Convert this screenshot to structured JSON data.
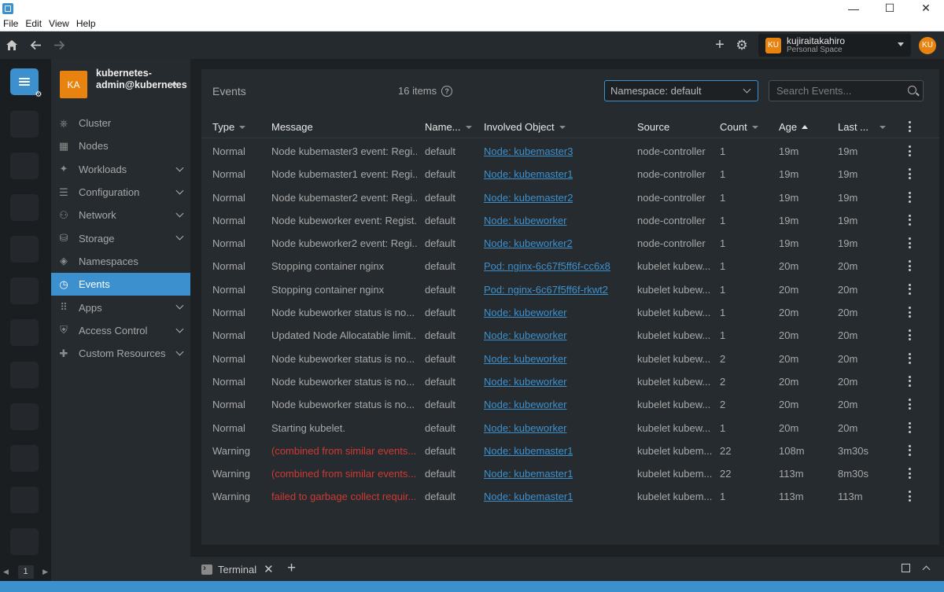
{
  "menu": [
    "File",
    "Edit",
    "View",
    "Help"
  ],
  "window_controls": {
    "minimize": "—",
    "maximize": "☐",
    "close": "✕"
  },
  "space": {
    "initials": "KU",
    "user": "kujiraitakahiro",
    "subtitle": "Personal Space"
  },
  "user_avatar": "KU",
  "cluster": {
    "initials": "KA",
    "name": "kubernetes-admin@kubernetes"
  },
  "nav": [
    {
      "label": "Cluster",
      "icon": "cluster-icon",
      "expandable": false
    },
    {
      "label": "Nodes",
      "icon": "nodes-icon",
      "expandable": false
    },
    {
      "label": "Workloads",
      "icon": "workloads-icon",
      "expandable": true
    },
    {
      "label": "Configuration",
      "icon": "configuration-icon",
      "expandable": true
    },
    {
      "label": "Network",
      "icon": "network-icon",
      "expandable": true
    },
    {
      "label": "Storage",
      "icon": "storage-icon",
      "expandable": true
    },
    {
      "label": "Namespaces",
      "icon": "namespaces-icon",
      "expandable": false
    },
    {
      "label": "Events",
      "icon": "events-icon",
      "expandable": false,
      "active": true
    },
    {
      "label": "Apps",
      "icon": "apps-icon",
      "expandable": true
    },
    {
      "label": "Access Control",
      "icon": "access-control-icon",
      "expandable": true
    },
    {
      "label": "Custom Resources",
      "icon": "custom-resources-icon",
      "expandable": true
    }
  ],
  "panel": {
    "title": "Events",
    "items_count": "16 items",
    "namespace_select": "Namespace: default",
    "search_placeholder": "Search Events..."
  },
  "columns": [
    "Type",
    "Message",
    "Name...",
    "Involved Object",
    "Source",
    "Count",
    "Age",
    "Last ..."
  ],
  "rows": [
    {
      "type": "Normal",
      "message": "Node kubemaster3 event: Regi...",
      "namespace": "default",
      "object": "Node: kubemaster3",
      "source": "node-controller",
      "count": "1",
      "age": "19m",
      "last": "19m",
      "warning": false
    },
    {
      "type": "Normal",
      "message": "Node kubemaster1 event: Regi...",
      "namespace": "default",
      "object": "Node: kubemaster1",
      "source": "node-controller",
      "count": "1",
      "age": "19m",
      "last": "19m",
      "warning": false
    },
    {
      "type": "Normal",
      "message": "Node kubemaster2 event: Regi...",
      "namespace": "default",
      "object": "Node: kubemaster2",
      "source": "node-controller",
      "count": "1",
      "age": "19m",
      "last": "19m",
      "warning": false
    },
    {
      "type": "Normal",
      "message": "Node kubeworker event: Regist...",
      "namespace": "default",
      "object": "Node: kubeworker",
      "source": "node-controller",
      "count": "1",
      "age": "19m",
      "last": "19m",
      "warning": false
    },
    {
      "type": "Normal",
      "message": "Node kubeworker2 event: Regi...",
      "namespace": "default",
      "object": "Node: kubeworker2",
      "source": "node-controller",
      "count": "1",
      "age": "19m",
      "last": "19m",
      "warning": false
    },
    {
      "type": "Normal",
      "message": "Stopping container nginx",
      "namespace": "default",
      "object": "Pod: nginx-6c67f5ff6f-cc6x8",
      "source": "kubelet kubew...",
      "count": "1",
      "age": "20m",
      "last": "20m",
      "warning": false
    },
    {
      "type": "Normal",
      "message": "Stopping container nginx",
      "namespace": "default",
      "object": "Pod: nginx-6c67f5ff6f-rkwt2",
      "source": "kubelet kubew...",
      "count": "1",
      "age": "20m",
      "last": "20m",
      "warning": false
    },
    {
      "type": "Normal",
      "message": "Node kubeworker status is no...",
      "namespace": "default",
      "object": "Node: kubeworker",
      "source": "kubelet kubew...",
      "count": "1",
      "age": "20m",
      "last": "20m",
      "warning": false
    },
    {
      "type": "Normal",
      "message": "Updated Node Allocatable limit...",
      "namespace": "default",
      "object": "Node: kubeworker",
      "source": "kubelet kubew...",
      "count": "1",
      "age": "20m",
      "last": "20m",
      "warning": false
    },
    {
      "type": "Normal",
      "message": "Node kubeworker status is no...",
      "namespace": "default",
      "object": "Node: kubeworker",
      "source": "kubelet kubew...",
      "count": "2",
      "age": "20m",
      "last": "20m",
      "warning": false
    },
    {
      "type": "Normal",
      "message": "Node kubeworker status is no...",
      "namespace": "default",
      "object": "Node: kubeworker",
      "source": "kubelet kubew...",
      "count": "2",
      "age": "20m",
      "last": "20m",
      "warning": false
    },
    {
      "type": "Normal",
      "message": "Node kubeworker status is no...",
      "namespace": "default",
      "object": "Node: kubeworker",
      "source": "kubelet kubew...",
      "count": "2",
      "age": "20m",
      "last": "20m",
      "warning": false
    },
    {
      "type": "Normal",
      "message": "Starting kubelet.",
      "namespace": "default",
      "object": "Node: kubeworker",
      "source": "kubelet kubew...",
      "count": "1",
      "age": "20m",
      "last": "20m",
      "warning": false
    },
    {
      "type": "Warning",
      "message": "(combined from similar events...",
      "namespace": "default",
      "object": "Node: kubemaster1",
      "source": "kubelet kubem...",
      "count": "22",
      "age": "108m",
      "last": "3m30s",
      "warning": true
    },
    {
      "type": "Warning",
      "message": "(combined from similar events...",
      "namespace": "default",
      "object": "Node: kubemaster1",
      "source": "kubelet kubem...",
      "count": "22",
      "age": "113m",
      "last": "8m30s",
      "warning": true
    },
    {
      "type": "Warning",
      "message": "failed to garbage collect requir...",
      "namespace": "default",
      "object": "Node: kubemaster1",
      "source": "kubelet kubem...",
      "count": "1",
      "age": "113m",
      "last": "113m",
      "warning": true
    }
  ],
  "dock": {
    "tab_label": "Terminal"
  },
  "hotbar": {
    "page": "1"
  },
  "colors": {
    "accent": "#3d90ce",
    "warning": "#ce3933",
    "avatar": "#e8830f"
  }
}
